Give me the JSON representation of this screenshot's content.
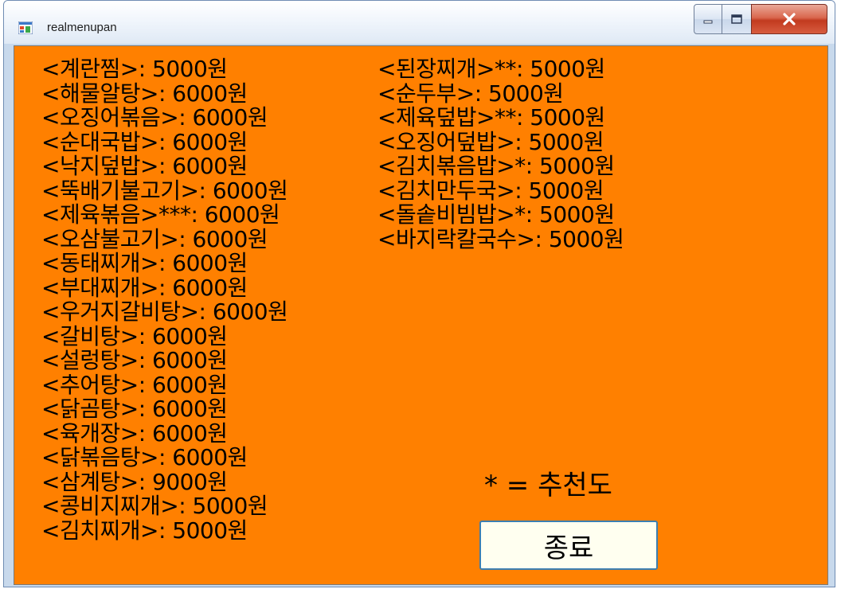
{
  "window": {
    "title": "realmenupan"
  },
  "menu": {
    "left": [
      "<계란찜>: 5000원",
      "<해물알탕>: 6000원",
      "<오징어볶음>: 6000원",
      "<순대국밥>: 6000원",
      "<낙지덮밥>: 6000원",
      "<뚝배기불고기>: 6000원",
      "<제육볶음>***: 6000원",
      "<오삼불고기>: 6000원",
      "<동태찌개>: 6000원",
      "<부대찌개>: 6000원",
      "<우거지갈비탕>: 6000원",
      "<갈비탕>: 6000원",
      "<설렁탕>: 6000원",
      "<추어탕>: 6000원",
      "<닭곰탕>: 6000원",
      "<육개장>: 6000원",
      "<닭볶음탕>: 6000원",
      "<삼계탕>: 9000원",
      "<콩비지찌개>: 5000원",
      "<김치찌개>: 5000원"
    ],
    "right": [
      "<된장찌개>**: 5000원",
      "<순두부>: 5000원",
      "<제육덮밥>**: 5000원",
      "<오징어덮밥>: 5000원",
      "<김치볶음밥>*: 5000원",
      "<김치만두국>: 5000원",
      "<돌솥비빔밥>*: 5000원",
      "<바지락칼국수>: 5000원"
    ]
  },
  "legend": {
    "text": "* = 추천도"
  },
  "exit_button": {
    "label": "종료"
  },
  "colors": {
    "background": "#ff8000",
    "button_face": "#fffff0",
    "button_border": "#3c7fb1"
  },
  "icons": {
    "app": "window-app-icon",
    "minimize": "minimize-icon",
    "maximize": "maximize-icon",
    "close": "close-icon"
  }
}
